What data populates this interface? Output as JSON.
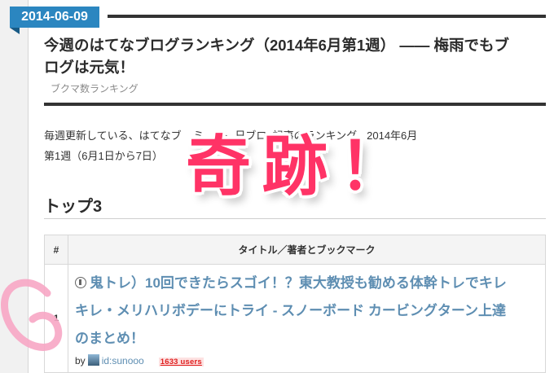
{
  "post": {
    "date": "2014-06-09",
    "title_line1": "今週のはてなブログランキング（2014年6月第1週） —— 梅雨でもブ",
    "title_line2": "ログは元気！",
    "category": "ブクマ数ランキング",
    "intro_line1": "毎週更新している、はてなブ    ミ     ト  日ブロ  記事のランキング。2014年6月",
    "intro_line2": "第1週（6月1日から7日）"
  },
  "section": {
    "heading": "トップ3"
  },
  "table": {
    "col_num": "#",
    "col_title": "タイトル／著者とブックマーク",
    "rows": [
      {
        "rank": "1",
        "title_line1": "鬼トレ）10回できたらスゴイ！？東大教授も勧める体幹トレでキレ",
        "title_line2": "キレ・メリハリボデーにトライ - スノーボード カービングターン上達",
        "title_line3": "のまとめ！",
        "by_label": "by",
        "author": "id:sunooo",
        "users": "1633 users"
      }
    ]
  },
  "overlay": {
    "stamp_text": "奇跡！"
  },
  "colors": {
    "ribbon": "#2b86c0",
    "link": "#5e8eb2",
    "stamp": "#ff3366",
    "scribble": "#f7a6c4"
  }
}
